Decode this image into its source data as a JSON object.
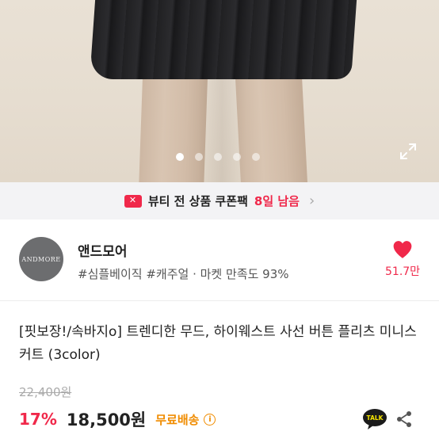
{
  "gallery": {
    "dot_count": 5,
    "active_dot": 0,
    "expand_icon": "expand-icon"
  },
  "coupon_bar": {
    "icon": "coupon-icon",
    "text": "뷰티 전 상품 쿠폰팩",
    "days_left": "8일 남음",
    "chevron": "›",
    "accent_color": "#f0284a"
  },
  "shop": {
    "logo_text": "ANDMORE",
    "name": "앤드모어",
    "tags": "#심플베이직 #캐주얼 · 마켓 만족도 93%",
    "likes": "51.7만",
    "heart_color": "#f0284a"
  },
  "product": {
    "title": "[핏보장!/속바지o] 트렌디한 무드, 하이웨스트 사선 버튼 플리츠 미니스커트 (3color)",
    "original_price": "22,400원",
    "discount": "17%",
    "price": "18,500원",
    "shipping": "무료배송",
    "shipping_info_icon": "ⓘ",
    "shipping_color": "#f08c00"
  },
  "actions": {
    "talk_label": "TALK",
    "share_icon": "share-icon"
  }
}
